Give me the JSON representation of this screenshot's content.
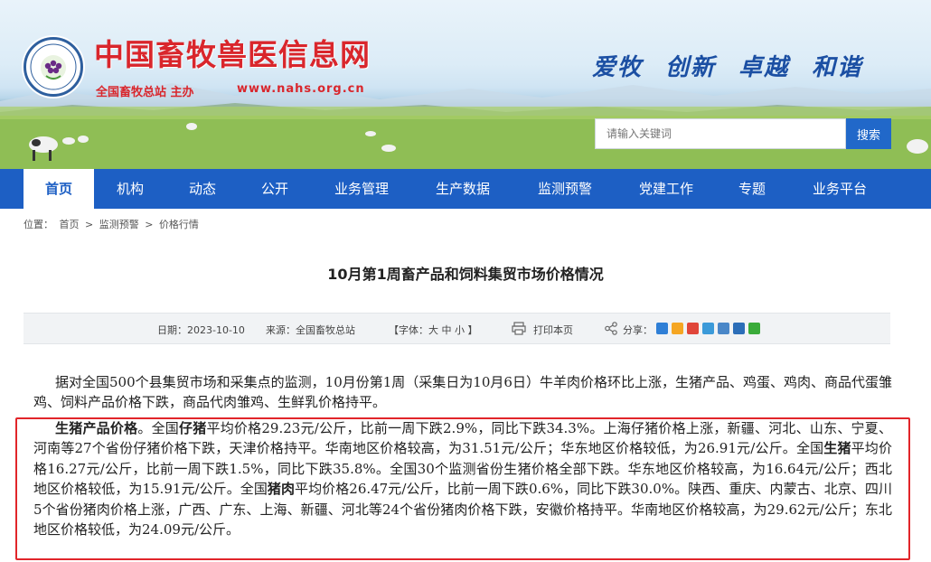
{
  "header": {
    "site_title": "中国畜牧兽医信息网",
    "organizer": "全国畜牧总站 主办",
    "url": "www.nahs.org.cn",
    "slogan": "爱牧 创新 卓越 和谐",
    "search_placeholder": "请输入关键词",
    "search_button": "搜索",
    "colors": {
      "brand_red": "#d9262c",
      "nav_blue": "#1d5fc4",
      "highlight_red": "#e1252a"
    }
  },
  "nav": {
    "items": [
      "首页",
      "机构",
      "动态",
      "公开",
      "业务管理",
      "生产数据",
      "监测预警",
      "党建工作",
      "专题",
      "业务平台"
    ],
    "active": "首页"
  },
  "breadcrumb": {
    "prefix": "位置：",
    "items": [
      "首页",
      "监测预警",
      "价格行情"
    ],
    "sep": ">"
  },
  "article": {
    "title": "10月第1周畜产品和饲料集贸市场价格情况",
    "date": "日期：2023-10-10",
    "source": "来源：全国畜牧总站",
    "font_size": "【字体：大  中  小 】",
    "print": "打印本页",
    "share": "分享：",
    "p1": "据对全国500个县集贸市场和采集点的监测，10月份第1周（采集日为10月6日）牛羊肉价格环比上涨，生猪产品、鸡蛋、鸡肉、商品代蛋雏鸡、饲料产品价格下跌，商品代肉雏鸡、生鲜乳价格持平。",
    "p2": {
      "s1": "生猪产品价格",
      "s2": "。全国",
      "s3": "仔猪",
      "s4": "平均价格29.23元/公斤，比前一周下跌2.9%，同比下跌34.3%。上海仔猪价格上涨，新疆、河北、山东、宁夏、河南等27个省份仔猪价格下跌，天津价格持平。华南地区价格较高，为31.51元/公斤；华东地区价格较低，为26.91元/公斤。全国",
      "s5": "生猪",
      "s6": "平均价格16.27元/公斤，比前一周下跌1.5%，同比下跌35.8%。全国30个监测省份生猪价格全部下跌。华东地区价格较高，为16.64元/公斤；西北地区价格较低，为15.91元/公斤。全国",
      "s7": "猪肉",
      "s8": "平均价格26.47元/公斤，比前一周下跌0.6%，同比下跌30.0%。陕西、重庆、内蒙古、北京、四川5个省份猪肉价格上涨，广西、广东、上海、新疆、河北等24个省份猪肉价格下跌，安徽价格持平。华南地区价格较高，为29.62元/公斤；东北地区价格较低，为24.09元/公斤。"
    }
  }
}
